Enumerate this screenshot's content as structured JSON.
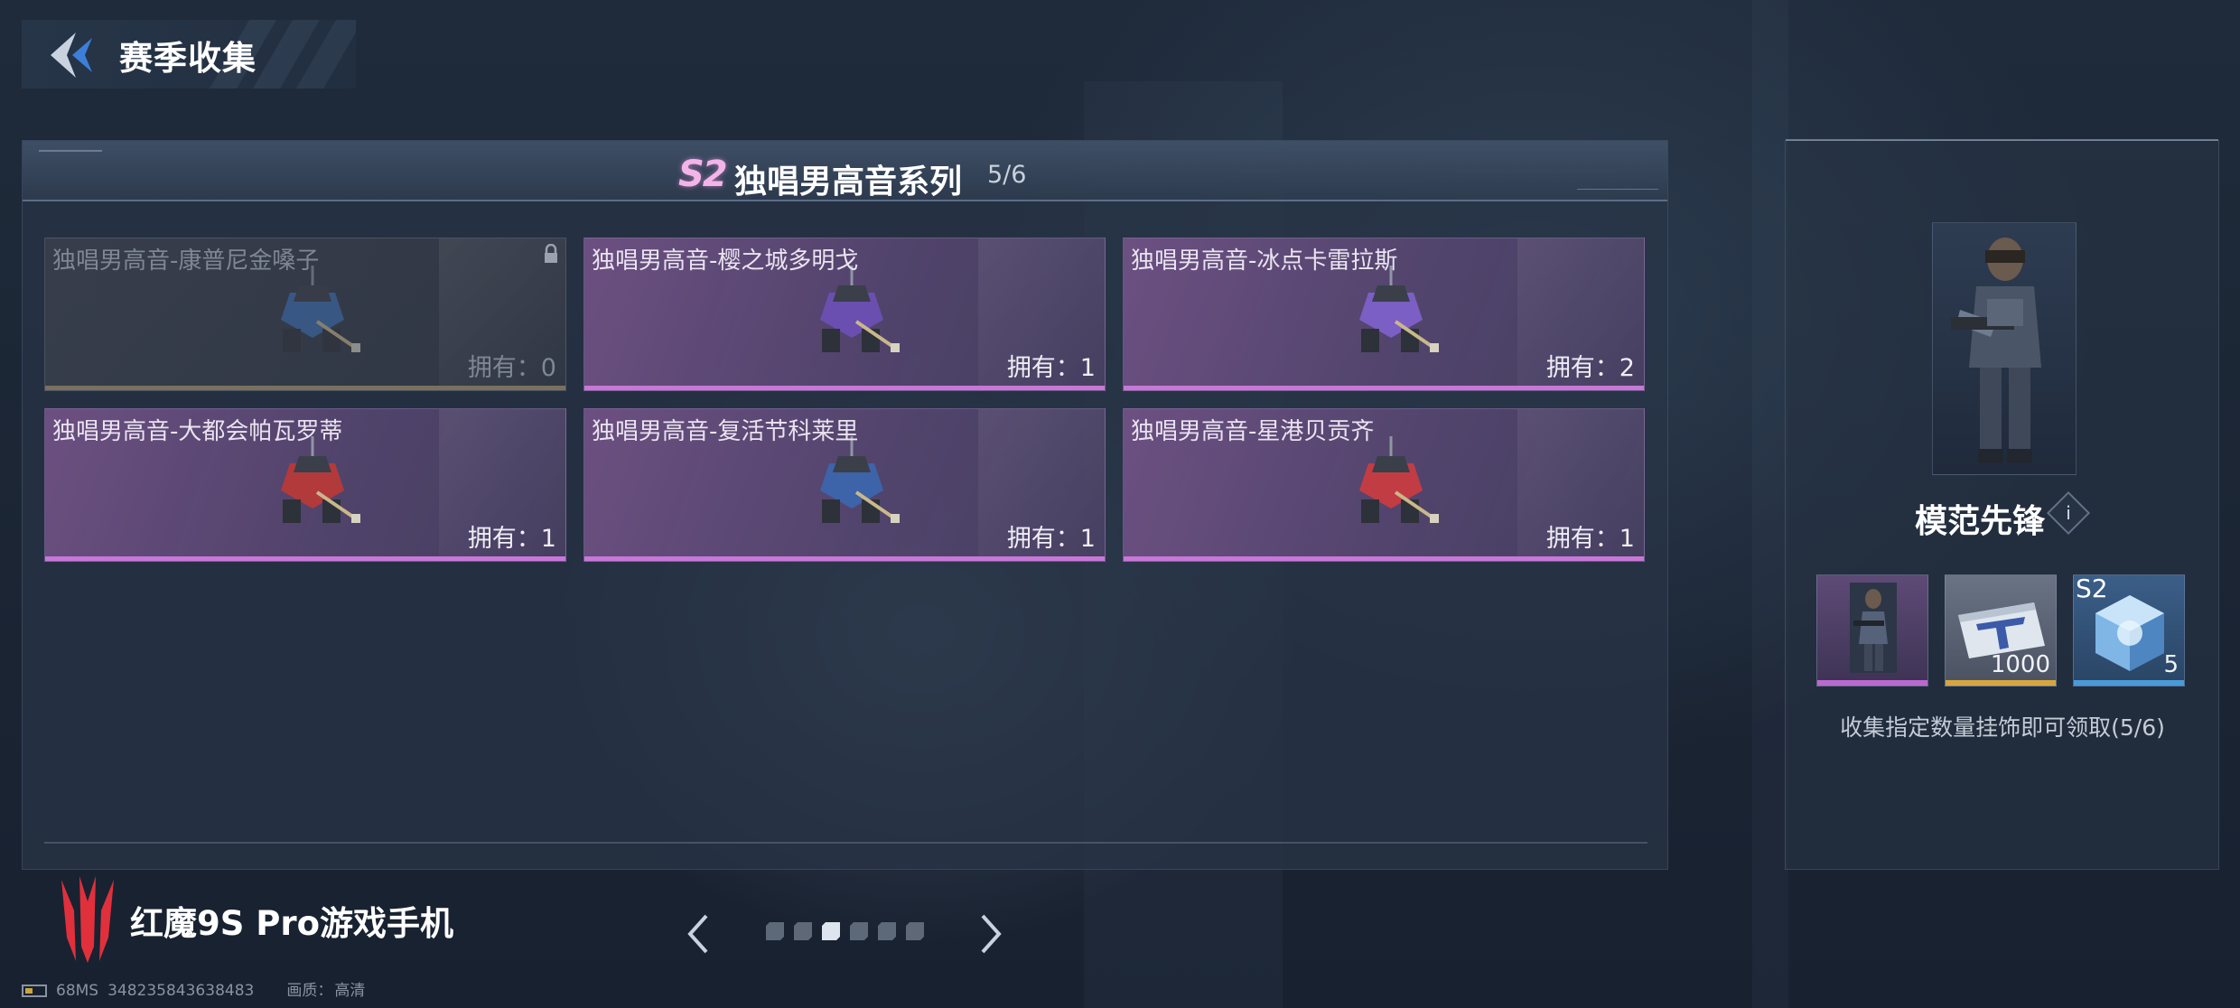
{
  "header": {
    "title": "赛季收集"
  },
  "series": {
    "badge": "S2",
    "title": "独唱男高音系列",
    "progress": "5/6"
  },
  "cards": [
    {
      "name": "独唱男高音-康普尼金嗓子",
      "owned": "拥有：0",
      "locked": true,
      "color": "#3e6fb5"
    },
    {
      "name": "独唱男高音-樱之城多明戈",
      "owned": "拥有：1",
      "locked": false,
      "color": "#6a4fb0"
    },
    {
      "name": "独唱男高音-冰点卡雷拉斯",
      "owned": "拥有：2",
      "locked": false,
      "color": "#7b5fc4"
    },
    {
      "name": "独唱男高音-大都会帕瓦罗蒂",
      "owned": "拥有：1",
      "locked": false,
      "color": "#b23a3a"
    },
    {
      "name": "独唱男高音-复活节科莱里",
      "owned": "拥有：1",
      "locked": false,
      "color": "#3d63a8"
    },
    {
      "name": "独唱男高音-星港贝贡齐",
      "owned": "拥有：1",
      "locked": false,
      "color": "#c23c44"
    }
  ],
  "reward": {
    "name": "模范先锋",
    "info_glyph": "i",
    "items": [
      {
        "type": "character",
        "qty": "",
        "tag": "",
        "bar_color": "#b96ad0"
      },
      {
        "type": "ticket",
        "qty": "1000",
        "tag": "",
        "bar_color": "#d5a640"
      },
      {
        "type": "crate",
        "qty": "5",
        "tag": "S2",
        "bar_color": "#4a9ad8"
      }
    ],
    "description": "收集指定数量挂饰即可领取(5/6)"
  },
  "pagination": {
    "total": 6,
    "current": 3
  },
  "brand": {
    "text": "红魔9S Pro游戏手机"
  },
  "status": {
    "fps": "68MS",
    "id": "348235843638483",
    "quality_label": "画质：",
    "quality_value": "高清"
  },
  "colors": {
    "accent_pink": "#c877d8",
    "accent_gold": "#d5a640",
    "accent_blue": "#4a9ad8",
    "brand_red": "#e0303c"
  }
}
